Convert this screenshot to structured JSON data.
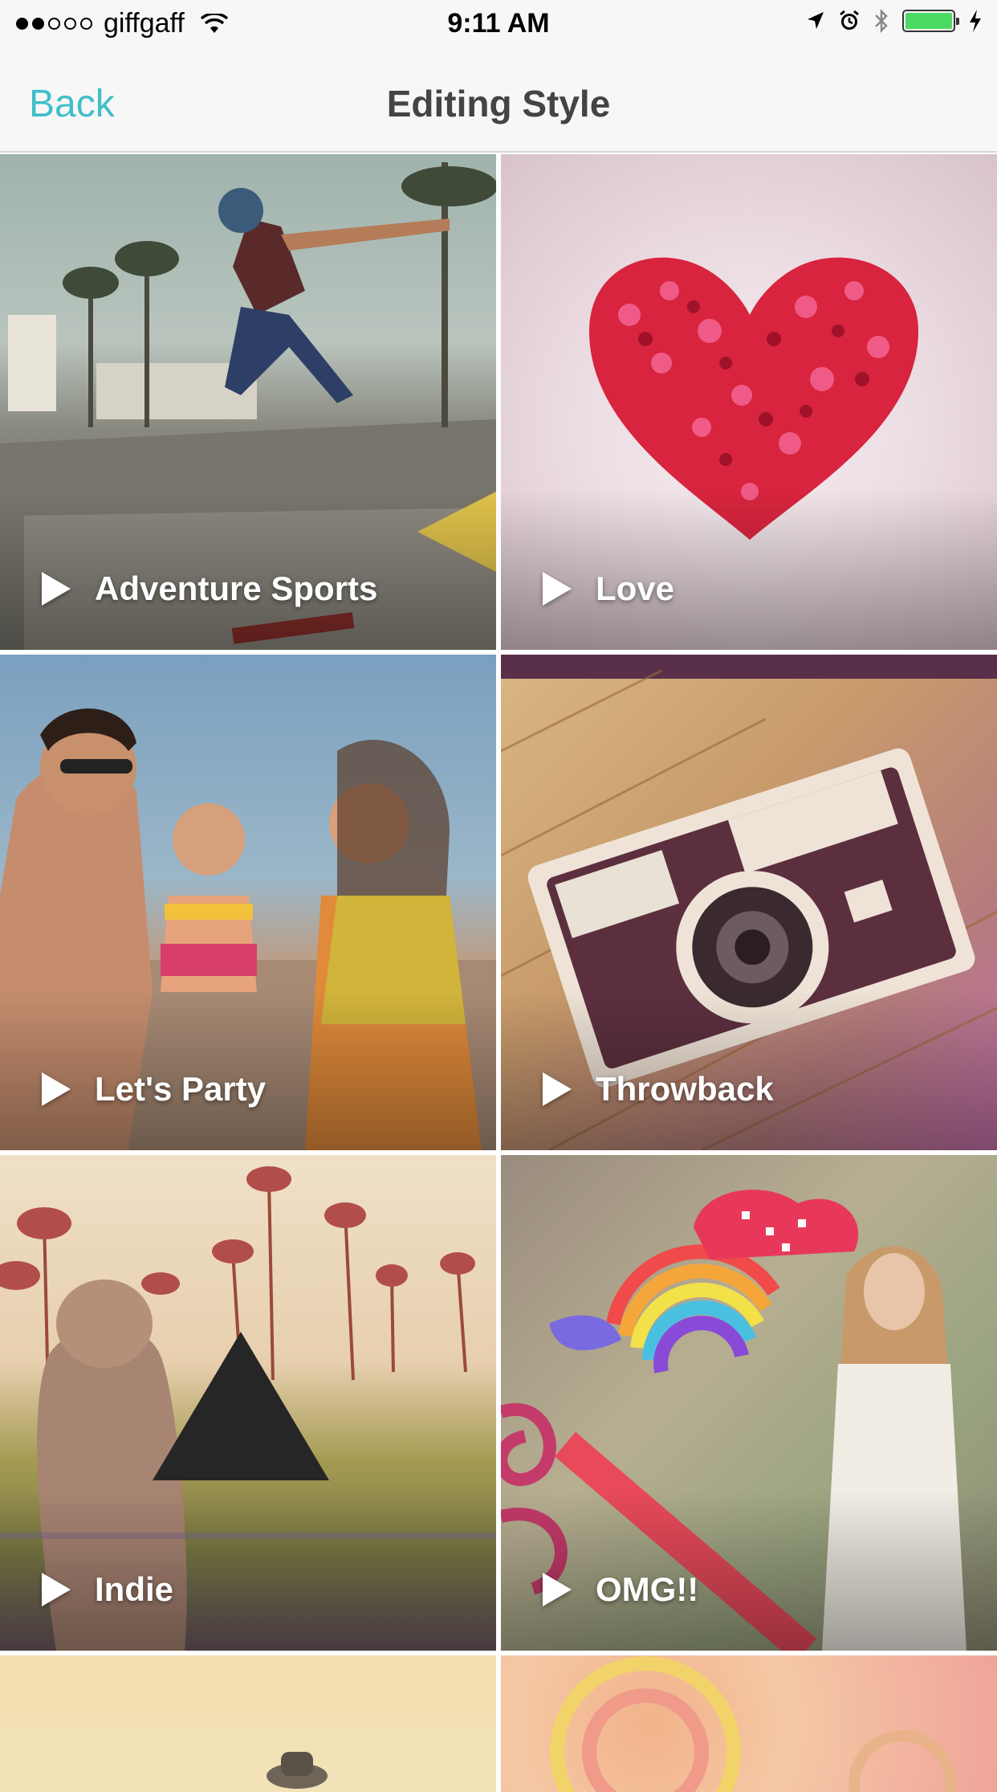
{
  "status_bar": {
    "carrier": "giffgaff",
    "signal_strength": 2,
    "signal_total": 5,
    "time": "9:11 AM",
    "battery_level": 1.0,
    "battery_color": "#4cd964"
  },
  "nav": {
    "back_label": "Back",
    "title": "Editing Style",
    "accent_color": "#3fbfc9"
  },
  "styles": [
    {
      "label": "Adventure Sports"
    },
    {
      "label": "Love"
    },
    {
      "label": "Let's Party"
    },
    {
      "label": "Throwback"
    },
    {
      "label": "Indie"
    },
    {
      "label": "OMG!!"
    }
  ]
}
